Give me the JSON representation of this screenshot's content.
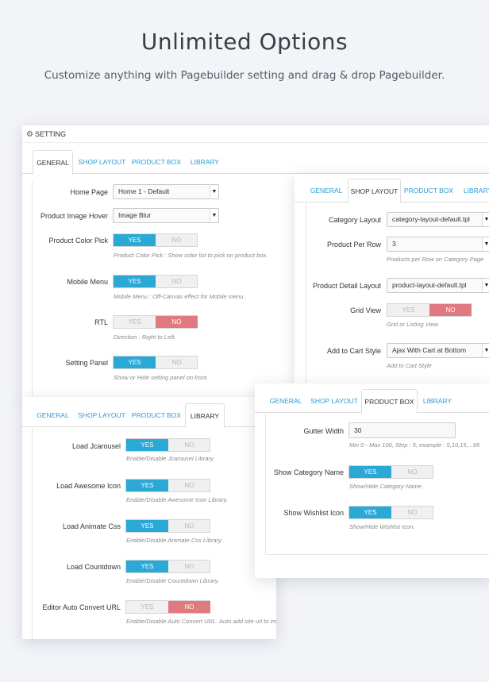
{
  "hero": {
    "title": "Unlimited Options",
    "subtitle": "Customize anything with Pagebuilder setting and drag & drop Pagebuilder."
  },
  "toggle_labels": {
    "yes": "YES",
    "no": "NO"
  },
  "setting_panel": {
    "header": "SETTING",
    "tabs": [
      "GENERAL",
      "SHOP LAYOUT",
      "PRODUCT BOX",
      "LIBRARY"
    ],
    "home_page": {
      "label": "Home Page",
      "value": "Home 1 - Default"
    },
    "product_image_hover": {
      "label": "Product Image Hover",
      "value": "Image Blur"
    },
    "product_color_pick": {
      "label": "Product Color Pick",
      "state": "yes",
      "help": "Product Color Pick : Show color list to pick on product box."
    },
    "mobile_menu": {
      "label": "Mobile Menu",
      "state": "yes",
      "help": "Mobile Menu : Off-Canvas effect for Mobile menu."
    },
    "rtl": {
      "label": "RTL",
      "state": "no",
      "help": "Direction : Right to Left."
    },
    "setting_panel_toggle": {
      "label": "Setting Panel",
      "state": "yes",
      "help": "Show or Hide setting panel on front."
    }
  },
  "shop_layout_panel": {
    "tabs": [
      "GENERAL",
      "SHOP LAYOUT",
      "PRODUCT BOX",
      "LIBRARY"
    ],
    "category_layout": {
      "label": "Category Layout",
      "value": "category-layout-default.tpl"
    },
    "product_per_row": {
      "label": "Product Per Row",
      "value": "3",
      "help": "Products per Row on Category Page"
    },
    "product_detail_layout": {
      "label": "Product Detail Layout",
      "value": "product-layout-default.tpl"
    },
    "grid_view": {
      "label": "Grid View",
      "state": "no",
      "help": "Grid or Listing View."
    },
    "add_to_cart_style": {
      "label": "Add to Cart Style",
      "value": "Ajax With Cart at Bottom",
      "help": "Add to Cart Style"
    }
  },
  "library_panel": {
    "tabs": [
      "GENERAL",
      "SHOP LAYOUT",
      "PRODUCT BOX",
      "LIBRARY"
    ],
    "load_jcarousel": {
      "label": "Load Jcarousel",
      "state": "yes",
      "help": "Enable/Disable Jcarousel Library."
    },
    "load_awesome_icon": {
      "label": "Load Awesome Icon",
      "state": "yes",
      "help": "Enable/Disable Awesome Icon Library."
    },
    "load_animate_css": {
      "label": "Load Animate Css",
      "state": "yes",
      "help": "Enable/Disable Animate Css Library."
    },
    "load_countdown": {
      "label": "Load Countdown",
      "state": "yes",
      "help": "Enable/Disable Countdown Library."
    },
    "editor_auto_convert_url": {
      "label": "Editor Auto Convert URL",
      "state": "no",
      "help": "Enable/Disable Auto Convert URL. Auto add site url to image src."
    }
  },
  "product_box_panel": {
    "tabs": [
      "GENERAL",
      "SHOP LAYOUT",
      "PRODUCT BOX",
      "LIBRARY"
    ],
    "gutter_width": {
      "label": "Gutter Width",
      "value": "30",
      "help": "Min 0 - Max 100, Step : 5, example : 5,10,15,...95"
    },
    "show_category_name": {
      "label": "Show Category Name",
      "state": "yes",
      "help": "Show/Hide Category Name."
    },
    "show_wishlist_icon": {
      "label": "Show Wishlist Icon",
      "state": "yes",
      "help": "Show/Hide Wishlist Icon."
    }
  },
  "colors": {
    "accent": "#2aa8d6",
    "off": "#e07a80",
    "link": "#2a9bd5"
  }
}
